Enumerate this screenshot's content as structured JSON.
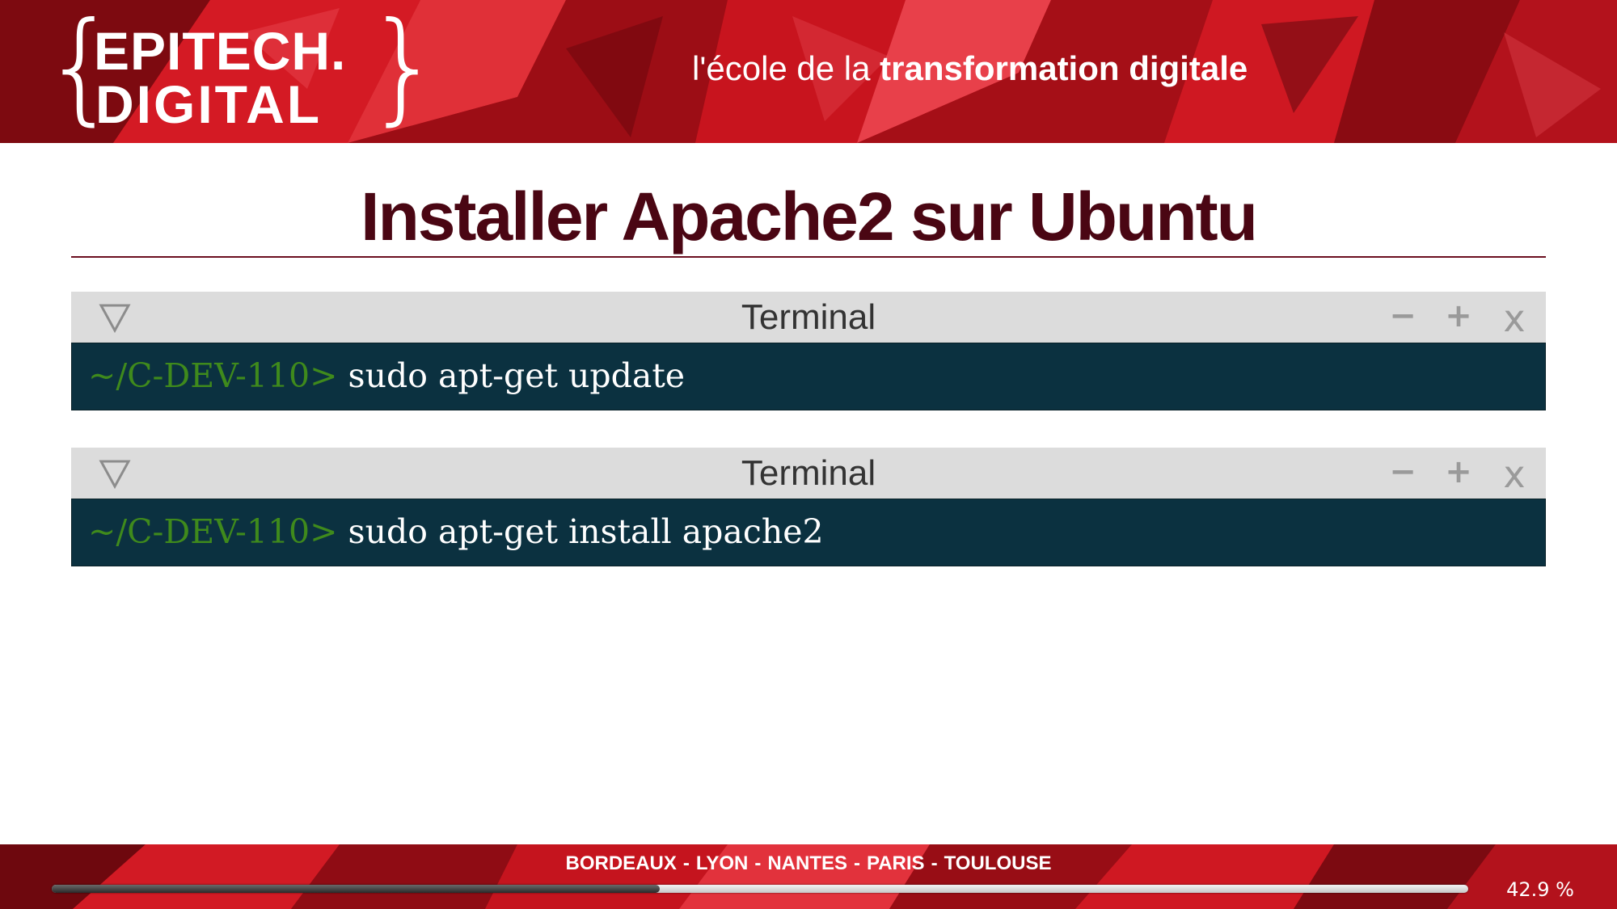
{
  "header": {
    "logo_line1": "EPITECH.",
    "logo_line2": "DIGITAL",
    "tagline_regular": "l'école de la ",
    "tagline_bold": "transformation digitale",
    "accent_color": "#c8101e"
  },
  "slide": {
    "title": "Installer Apache2 sur Ubuntu",
    "title_color": "#4a0613"
  },
  "terminals": [
    {
      "title": "Terminal",
      "collapse_icon": "triangle-down-icon",
      "min_label": "−",
      "max_label": "+",
      "close_label": "x",
      "prompt": "~/C-DEV-110> ",
      "command": "sudo apt-get update"
    },
    {
      "title": "Terminal",
      "collapse_icon": "triangle-down-icon",
      "min_label": "−",
      "max_label": "+",
      "close_label": "x",
      "prompt": "~/C-DEV-110> ",
      "command": "sudo apt-get install apache2"
    }
  ],
  "footer": {
    "cities": [
      "BORDEAUX",
      "LYON",
      "NANTES",
      "PARIS",
      "TOULOUSE"
    ],
    "separator": "-",
    "progress_fraction": 0.429,
    "progress_text": "42.9 %"
  },
  "colors": {
    "terminal_body": "#0b3140",
    "terminal_bar": "#dcdcdc",
    "prompt": "#3f8a1c",
    "command": "#ffffff"
  }
}
